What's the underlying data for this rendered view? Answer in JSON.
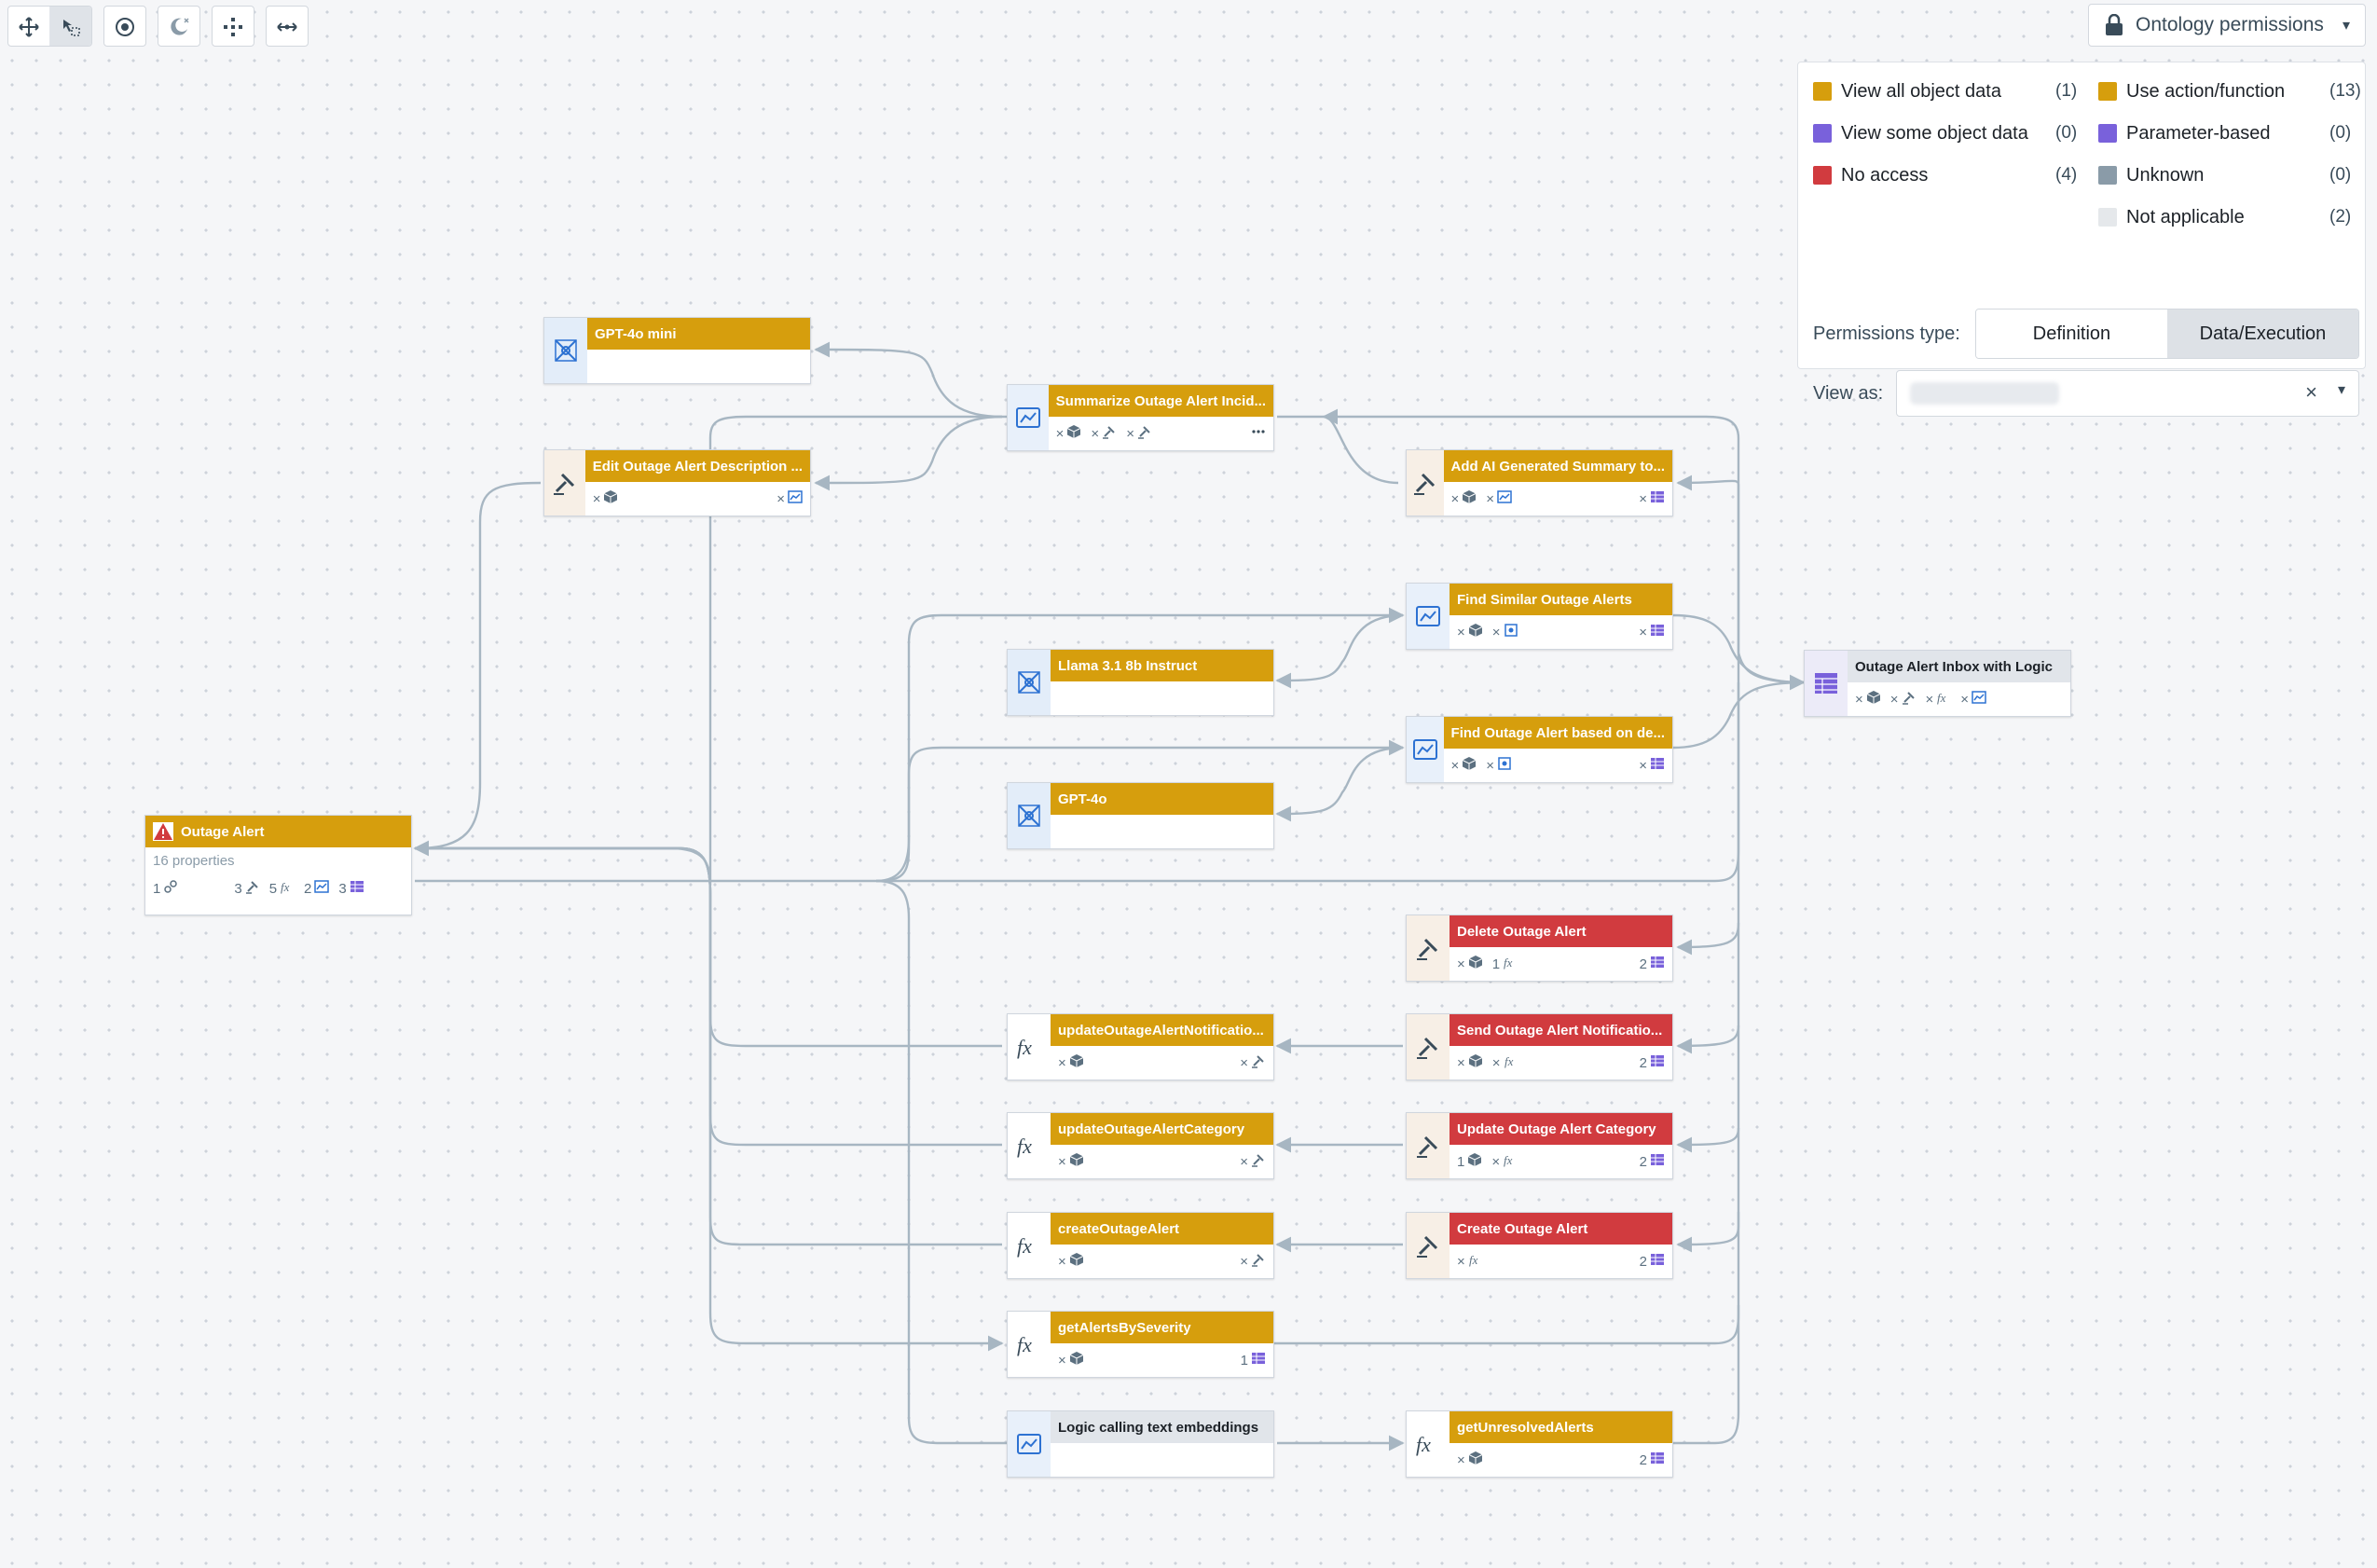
{
  "toolbar": {
    "tools": [
      {
        "icon": "move-icon",
        "active": false
      },
      {
        "icon": "select-icon",
        "active": true
      },
      {
        "icon": "target-icon",
        "active": false
      },
      {
        "icon": "moon-icon",
        "active": false
      },
      {
        "icon": "layout-icon",
        "active": false
      },
      {
        "icon": "expand-icon",
        "active": false
      }
    ]
  },
  "permissions_dropdown": {
    "label": "Ontology permissions",
    "icon": "lock-icon"
  },
  "legend": {
    "left": [
      {
        "label": "View all object data",
        "count": "(1)",
        "color": "#d69e0d"
      },
      {
        "label": "View some object data",
        "count": "(0)",
        "color": "#7961db"
      },
      {
        "label": "No access",
        "count": "(4)",
        "color": "#d13b3f"
      }
    ],
    "right": [
      {
        "label": "Use action/function",
        "count": "(13)",
        "color": "#d69e0d"
      },
      {
        "label": "Parameter-based",
        "count": "(0)",
        "color": "#7961db"
      },
      {
        "label": "Unknown",
        "count": "(0)",
        "color": "#8a9ba8"
      },
      {
        "label": "Not applicable",
        "count": "(2)",
        "color": "#e5e8eb"
      }
    ],
    "permissions_type_label": "Permissions type:",
    "tabs": [
      "Definition",
      "Data/Execution"
    ],
    "active_tab": "Data/Execution",
    "view_as_label": "View as:",
    "clear_glyph": "×",
    "caret_glyph": "▾"
  },
  "colors": {
    "yellow": "#d69e0d",
    "red": "#d13b3f",
    "gray": "#e1e5ea",
    "edge": "#a7b6c2"
  },
  "outage_alert": {
    "title": "Outage Alert",
    "subtitle": "16 properties",
    "stats": [
      {
        "count": "1",
        "icon": "link-icon"
      },
      {
        "count": "3",
        "icon": "action-icon"
      },
      {
        "count": "5",
        "icon": "function-icon"
      },
      {
        "count": "2",
        "icon": "logic-icon"
      },
      {
        "count": "3",
        "icon": "table-icon"
      }
    ]
  },
  "nodes": [
    {
      "id": "gpt4o-mini",
      "title": "GPT-4o mini",
      "type": "model",
      "color": "yellow",
      "left": [],
      "right": []
    },
    {
      "id": "summarize",
      "title": "Summarize Outage Alert Incid...",
      "type": "logic",
      "color": "yellow",
      "left": [
        [
          "×",
          "cube-icon"
        ],
        [
          "×",
          "action-icon"
        ],
        [
          "×",
          "action-icon"
        ]
      ],
      "right": [
        [
          "",
          "more-icon"
        ]
      ]
    },
    {
      "id": "edit-desc",
      "title": "Edit Outage Alert Description ...",
      "type": "action",
      "color": "yellow",
      "left": [
        [
          "×",
          "cube-icon"
        ]
      ],
      "right": [
        [
          "×",
          "logic-icon"
        ]
      ]
    },
    {
      "id": "add-ai",
      "title": "Add AI Generated Summary to...",
      "type": "action",
      "color": "yellow",
      "left": [
        [
          "×",
          "cube-icon"
        ],
        [
          "×",
          "logic-icon"
        ]
      ],
      "right": [
        [
          "×",
          "table-icon"
        ]
      ]
    },
    {
      "id": "find-similar",
      "title": "Find Similar Outage Alerts",
      "type": "logic",
      "color": "yellow",
      "left": [
        [
          "×",
          "cube-icon"
        ],
        [
          "×",
          "embed-icon"
        ]
      ],
      "right": [
        [
          "×",
          "table-icon"
        ]
      ]
    },
    {
      "id": "llama",
      "title": "Llama 3.1 8b Instruct",
      "type": "model",
      "color": "yellow",
      "left": [],
      "right": []
    },
    {
      "id": "inbox",
      "title": "Outage Alert Inbox with Logic",
      "type": "inbox",
      "color": "gray",
      "left": [
        [
          "×",
          "cube-icon"
        ],
        [
          "×",
          "action-icon"
        ],
        [
          "×",
          "function-icon"
        ],
        [
          "×",
          "logic-icon"
        ]
      ],
      "right": []
    },
    {
      "id": "find-based",
      "title": "Find Outage Alert based on de...",
      "type": "logic",
      "color": "yellow",
      "left": [
        [
          "×",
          "cube-icon"
        ],
        [
          "×",
          "embed-icon"
        ]
      ],
      "right": [
        [
          "×",
          "table-icon"
        ]
      ]
    },
    {
      "id": "gpt4o",
      "title": "GPT-4o",
      "type": "model",
      "color": "yellow",
      "left": [],
      "right": []
    },
    {
      "id": "delete",
      "title": "Delete Outage Alert",
      "type": "action",
      "color": "red",
      "left": [
        [
          "×",
          "cube-icon"
        ],
        [
          "1",
          "function-icon"
        ]
      ],
      "right": [
        [
          "2",
          "table-icon"
        ]
      ]
    },
    {
      "id": "update-notif",
      "title": "updateOutageAlertNotificatio...",
      "type": "fn",
      "color": "yellow",
      "left": [
        [
          "×",
          "cube-icon"
        ]
      ],
      "right": [
        [
          "×",
          "action-icon"
        ]
      ]
    },
    {
      "id": "send-notif",
      "title": "Send Outage Alert Notificatio...",
      "type": "action",
      "color": "red",
      "left": [
        [
          "×",
          "cube-icon"
        ],
        [
          "×",
          "function-icon"
        ]
      ],
      "right": [
        [
          "2",
          "table-icon"
        ]
      ]
    },
    {
      "id": "update-cat-fn",
      "title": "updateOutageAlertCategory",
      "type": "fn",
      "color": "yellow",
      "left": [
        [
          "×",
          "cube-icon"
        ]
      ],
      "right": [
        [
          "×",
          "action-icon"
        ]
      ]
    },
    {
      "id": "update-cat",
      "title": "Update Outage Alert Category",
      "type": "action",
      "color": "red",
      "left": [
        [
          "1",
          "cube-icon"
        ],
        [
          "×",
          "function-icon"
        ]
      ],
      "right": [
        [
          "2",
          "table-icon"
        ]
      ]
    },
    {
      "id": "create-fn",
      "title": "createOutageAlert",
      "type": "fn",
      "color": "yellow",
      "left": [
        [
          "×",
          "cube-icon"
        ]
      ],
      "right": [
        [
          "×",
          "action-icon"
        ]
      ]
    },
    {
      "id": "create",
      "title": "Create Outage Alert",
      "type": "action",
      "color": "red",
      "left": [
        [
          "×",
          "function-icon"
        ]
      ],
      "right": [
        [
          "2",
          "table-icon"
        ]
      ]
    },
    {
      "id": "get-severity",
      "title": "getAlertsBySeverity",
      "type": "fn",
      "color": "yellow",
      "left": [
        [
          "×",
          "cube-icon"
        ]
      ],
      "right": [
        [
          "1",
          "table-icon"
        ]
      ]
    },
    {
      "id": "logic-embed",
      "title": "Logic calling text embeddings",
      "type": "logic",
      "color": "gray",
      "left": [],
      "right": []
    },
    {
      "id": "get-unresolved",
      "title": "getUnresolvedAlerts",
      "type": "fn",
      "color": "yellow",
      "left": [
        [
          "×",
          "cube-icon"
        ]
      ],
      "right": [
        [
          "2",
          "table-icon"
        ]
      ]
    }
  ]
}
